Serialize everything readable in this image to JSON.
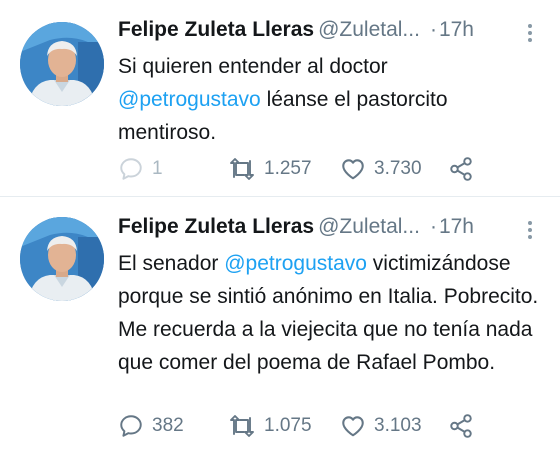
{
  "tweets": [
    {
      "author_name": "Felipe Zuleta Lleras",
      "handle": "@Zuletal...",
      "dot": "·",
      "time": "17h",
      "text_parts": [
        "Si quieren entender al doctor ",
        "@petrogustavo",
        " léanse el pastorcito mentiroso."
      ],
      "reply_count": "1",
      "retweet_count": "1.257",
      "like_count": "3.730"
    },
    {
      "author_name": "Felipe Zuleta Lleras",
      "handle": "@Zuletal...",
      "dot": "·",
      "time": "17h",
      "text_parts": [
        "El senador ",
        "@petrogustavo",
        " victimizándose porque se sintió anónimo en Italia. Pobrecito. Me recuerda a la viejecita que no tenía nada que comer del poema de Rafael Pombo."
      ],
      "reply_count": "382",
      "retweet_count": "1.075",
      "like_count": "3.103"
    }
  ],
  "icons": {
    "reply": "reply-icon",
    "retweet": "retweet-icon",
    "like": "like-icon",
    "share": "share-icon",
    "more": "more-options-icon"
  },
  "colors": {
    "text": "#14171a",
    "secondary": "#657786",
    "mention": "#1da1f2",
    "divider": "#e6ecf0"
  }
}
